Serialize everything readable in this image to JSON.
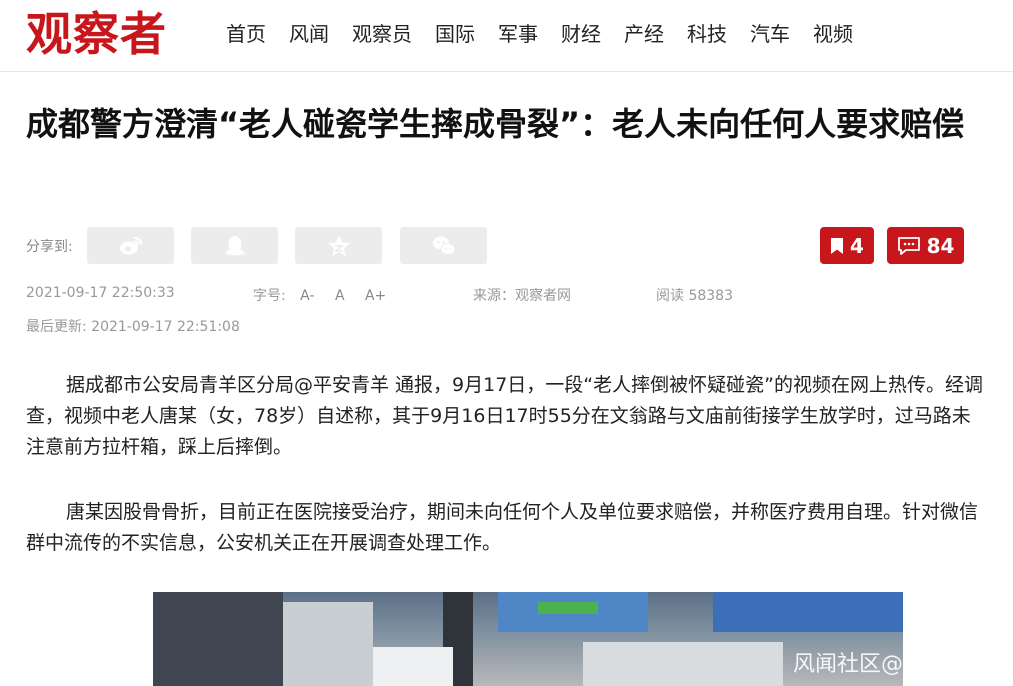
{
  "header": {
    "logo_text": "观察者",
    "nav": [
      "首页",
      "风闻",
      "观察员",
      "国际",
      "军事",
      "财经",
      "产经",
      "科技",
      "汽车",
      "视频"
    ]
  },
  "article": {
    "title": "成都警方澄清“老人碰瓷学生摔成骨裂”：老人未向任何人要求赔偿",
    "share_label": "分享到:",
    "share_icons": [
      "weibo-icon",
      "qq-icon",
      "qzone-star-icon",
      "wechat-icon"
    ],
    "bookmark_count": "4",
    "comment_count": "84",
    "datetime": "2021-09-17 22:50:33",
    "font_size_label": "字号:",
    "font_size_options": [
      "A-",
      "A",
      "A+"
    ],
    "source": "来源：观察者网",
    "read_count": "阅读 58383",
    "last_updated": "最后更新: 2021-09-17 22:51:08",
    "paragraphs": [
      "据成都市公安局青羊区分局@平安青羊 通报，9月17日，一段“老人摔倒被怀疑碰瓷”的视频在网上热传。经调查，视频中老人唐某（女，78岁）自述称，其于9月16日17时55分在文翁路与文庙前街接学生放学时，过马路未注意前方拉杆箱，踩上后摔倒。",
      "唐某因股骨骨折，目前正在医院接受治疗，期间未向任何个人及单位要求赔偿，并称医疗费用自理。针对微信群中流传的不实信息，公安机关正在开展调查处理工作。"
    ],
    "video_watermark": "风闻社区@"
  },
  "colors": {
    "brand_red": "#c8161d",
    "share_bg": "#ececec",
    "meta_gray": "#999999"
  }
}
